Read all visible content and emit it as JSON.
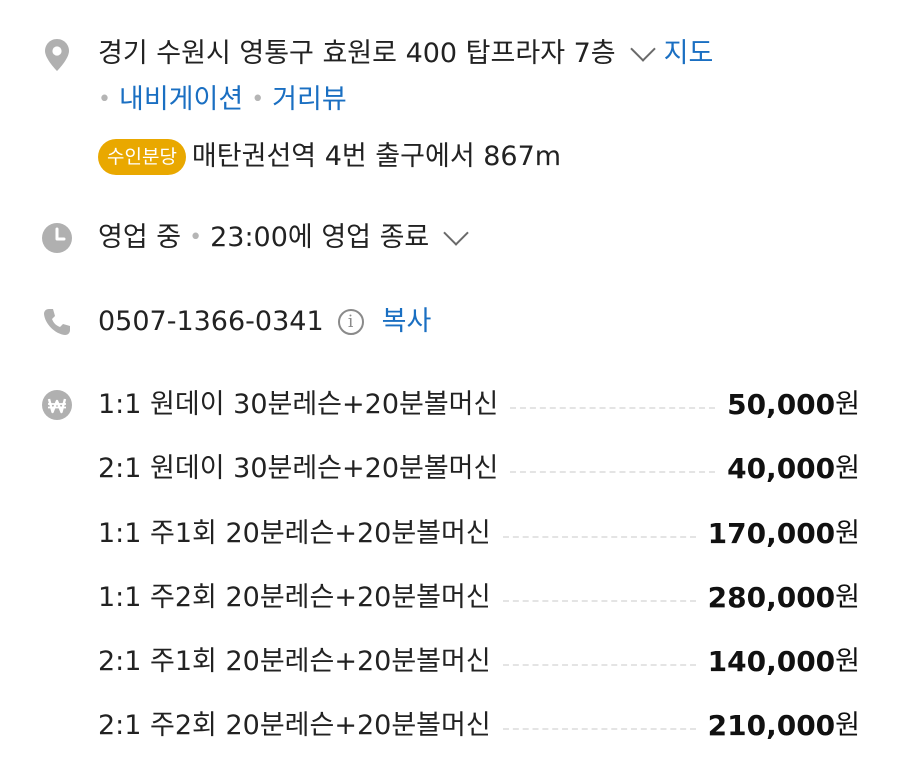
{
  "address": {
    "text": "경기 수원시 영통구 효원로 400 탑프라자 7층",
    "map_link": "지도",
    "nav_link": "내비게이션",
    "roadview_link": "거리뷰",
    "badge": "수인분당",
    "transit": "매탄권선역 4번 출구에서 867m"
  },
  "hours": {
    "status": "영업 중",
    "close": "23:00에 영업 종료"
  },
  "phone": {
    "number": "0507-1366-0341",
    "copy": "복사"
  },
  "prices": [
    {
      "name": "1:1 원데이 30분레슨+20분볼머신",
      "amount": "50,000",
      "unit": "원"
    },
    {
      "name": "2:1 원데이 30분레슨+20분볼머신",
      "amount": "40,000",
      "unit": "원"
    },
    {
      "name": "1:1 주1회 20분레슨+20분볼머신",
      "amount": "170,000",
      "unit": "원"
    },
    {
      "name": "1:1 주2회 20분레슨+20분볼머신",
      "amount": "280,000",
      "unit": "원"
    },
    {
      "name": "2:1 주1회 20분레슨+20분볼머신",
      "amount": "140,000",
      "unit": "원"
    },
    {
      "name": "2:1 주2회 20분레슨+20분볼머신",
      "amount": "210,000",
      "unit": "원"
    }
  ],
  "colors": {
    "link": "#1a6fc2",
    "badge": "#e9a800",
    "icon": "#b0b0b0"
  },
  "icons": [
    "location-pin-icon",
    "clock-icon",
    "phone-icon",
    "won-icon",
    "info-icon",
    "chevron-down-icon"
  ]
}
